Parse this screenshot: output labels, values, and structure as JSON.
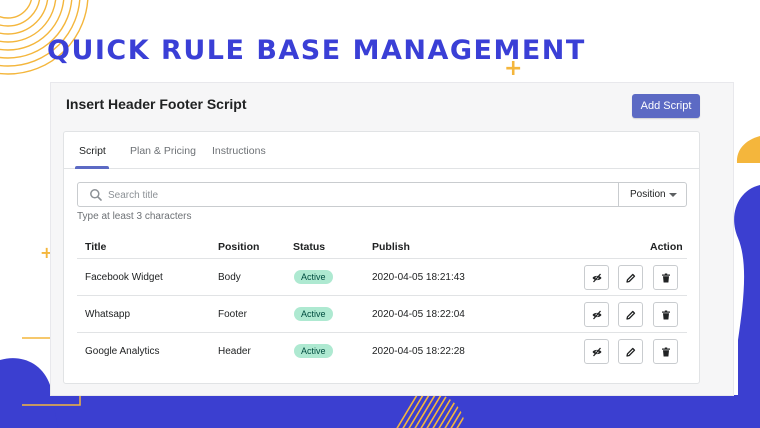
{
  "headline": "Quick rule base management",
  "app": {
    "title": "Insert Header Footer Script",
    "add_button": "Add Script",
    "tabs": [
      {
        "label": "Script",
        "active": true
      },
      {
        "label": "Plan & Pricing",
        "active": false
      },
      {
        "label": "Instructions",
        "active": false
      }
    ],
    "search": {
      "placeholder": "Search title",
      "value": "",
      "icon": "search-icon",
      "hint": "Type at least 3 characters"
    },
    "position_filter": "Position",
    "table": {
      "headers": {
        "title": "Title",
        "position": "Position",
        "status": "Status",
        "publish": "Publish",
        "action": "Action"
      },
      "rows": [
        {
          "title": "Facebook Widget",
          "position": "Body",
          "status": "Active",
          "publish": "2020-04-05 18:21:43"
        },
        {
          "title": "Whatsapp",
          "position": "Footer",
          "status": "Active",
          "publish": "2020-04-05 18:22:04"
        },
        {
          "title": "Google Analytics",
          "position": "Header",
          "status": "Active",
          "publish": "2020-04-05 18:22:28"
        }
      ],
      "action_icons": [
        "eye-off-icon",
        "pencil-icon",
        "trash-icon"
      ]
    }
  },
  "colors": {
    "brand_blue": "#3a3fd6",
    "accent_yellow": "#f4b63c",
    "primary_button": "#5c6ac4",
    "badge_bg": "#aee9d1"
  }
}
